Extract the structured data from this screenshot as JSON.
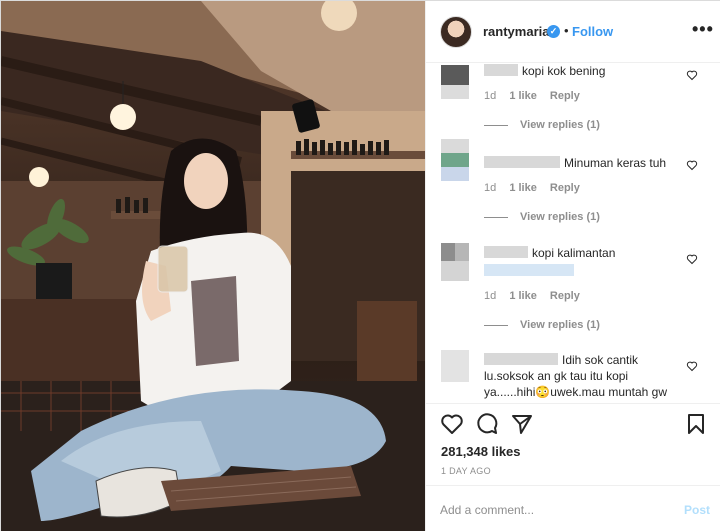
{
  "header": {
    "username": "rantymaria",
    "verified_icon": "verified-badge-icon",
    "separator": "•",
    "follow_label": "Follow",
    "more_label": "•••"
  },
  "comments": [
    {
      "text": "kopi kok bening",
      "time": "1d",
      "likes": "1 like",
      "reply_label": "Reply",
      "view_replies": "View replies (1)"
    },
    {
      "text": "Minuman keras tuh",
      "time": "1d",
      "likes": "1 like",
      "reply_label": "Reply",
      "view_replies": "View replies (1)"
    },
    {
      "text": "kopi kalimantan",
      "time": "1d",
      "likes": "1 like",
      "reply_label": "Reply",
      "view_replies": "View replies (1)"
    },
    {
      "line1": "Idih sok cantik",
      "line2": "lu.soksok an gk tau itu kopi",
      "line3": "ya......hihi😳uwek.mau muntah gw"
    }
  ],
  "actions": {
    "like_icon": "heart-outline-icon",
    "comment_icon": "comment-bubble-icon",
    "share_icon": "paper-plane-icon",
    "save_icon": "bookmark-icon",
    "likes_count": "281,348 likes",
    "age": "1 DAY AGO"
  },
  "add_comment": {
    "placeholder": "Add a comment...",
    "post_label": "Post"
  },
  "colors": {
    "accent": "#3897f0",
    "muted": "#8e8e8e",
    "post_disabled": "#b2dffc"
  }
}
